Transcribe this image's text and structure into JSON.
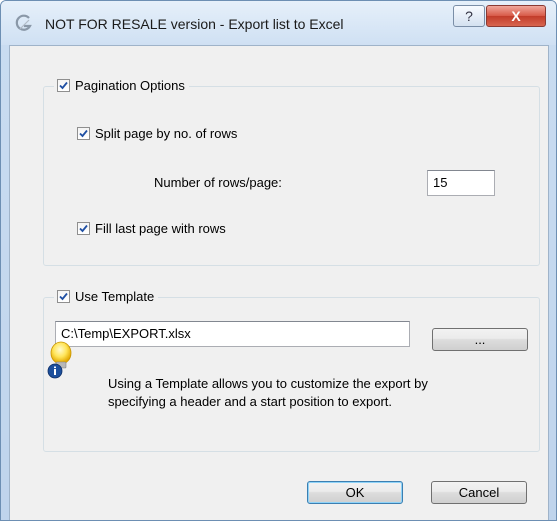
{
  "window": {
    "title": "NOT FOR RESALE version - Export list to Excel",
    "help_glyph": "?",
    "close_glyph": "X"
  },
  "pagination": {
    "legend": "Pagination Options",
    "checked": true,
    "split_label": "Split page by no. of rows",
    "split_checked": true,
    "rows_label": "Number of rows/page:",
    "rows_value": "15",
    "fill_label": "Fill last page with rows",
    "fill_checked": true
  },
  "template": {
    "legend": "Use Template",
    "checked": true,
    "path_value": "C:\\Temp\\EXPORT.xlsx",
    "browse_label": "...",
    "info_text_line1": "Using a Template allows you to customize the export by",
    "info_text_line2": "specifying a header and a start position to export."
  },
  "buttons": {
    "ok_label": "OK",
    "cancel_label": "Cancel"
  },
  "icons": {
    "app": "app-logo-icon",
    "help": "help-icon",
    "close": "close-icon",
    "checkbox": "checkmark-icon",
    "info": "lightbulb-info-icon"
  },
  "colors": {
    "title_bar": "#cfe0f3",
    "close_button": "#c94a37",
    "dialog_background": "#f0f0f0",
    "checkbox_tick": "#1f4fa3"
  }
}
